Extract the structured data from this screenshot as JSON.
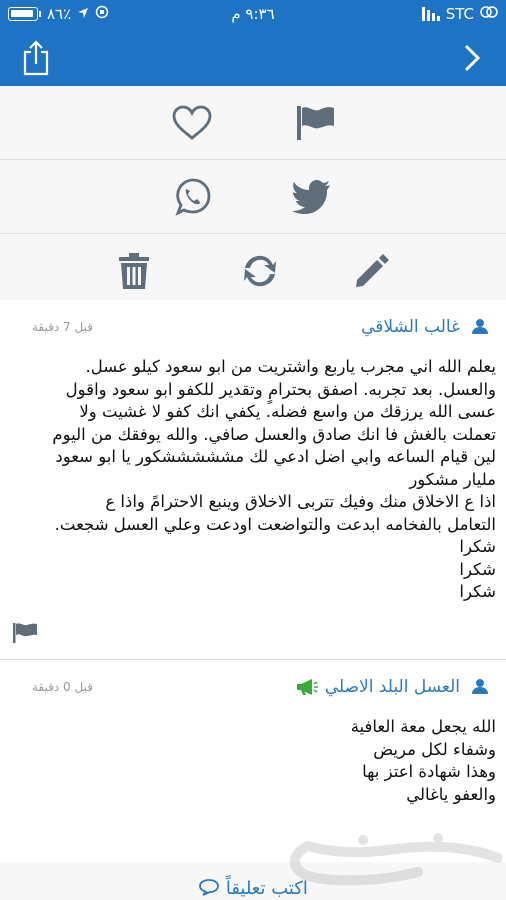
{
  "status_bar": {
    "battery": "٨٦٪",
    "time": "٩:٣٦ م",
    "carrier": "STC"
  },
  "actions": {
    "row1": [
      "heart-icon",
      "flag-icon"
    ],
    "row2": [
      "whatsapp-icon",
      "twitter-icon"
    ],
    "row3": [
      "trash-icon",
      "refresh-icon",
      "pencil-icon"
    ]
  },
  "comments": [
    {
      "author": "غالب الشلاقي",
      "time": "قبل 7 دقيقة",
      "lines": [
        "يعلم الله اني مجرب ياربع واشتريت من ابو سعود كيلو عسل.",
        "والعسل. بعد تجربه. اصفق بحترامٍ وتقدير للكفو ابو سعود واقول",
        "عسى الله يرزقك من واسع فضله. يكفي انك كفو لا غشيت ولا",
        "تعملت بالغش فا انك صادق والعسل صافي. والله يوفقك من اليوم",
        "لين قيام الساعه وابي اضل ادعي لك مشششششكور يا ابو سعود",
        "مليار مشكور",
        "اذا ع الاخلاق منك وفيك تتربى الاخلاق وينبع الاحترامً واذا ع",
        "التعامل بالفخامه ابدعت والتواضعت اودعت وعلي العسل شجعت.",
        "شكرا",
        "شكرا",
        "شكرا"
      ]
    },
    {
      "author": "العسل البلد الاصلي",
      "time": "قبل 0 دقيقة",
      "lines": [
        "الله يجعل معة العافية",
        "وشفاء لكل مريض",
        "وهذا شهادة اعتز بها",
        "والعفو ياغالي"
      ]
    }
  ],
  "write_comment": "اكتب تعليقاً",
  "watermark": "حراج",
  "colors": {
    "primary": "#1e73c4",
    "link": "#2a7ac0",
    "icon": "#5f6e7a"
  }
}
